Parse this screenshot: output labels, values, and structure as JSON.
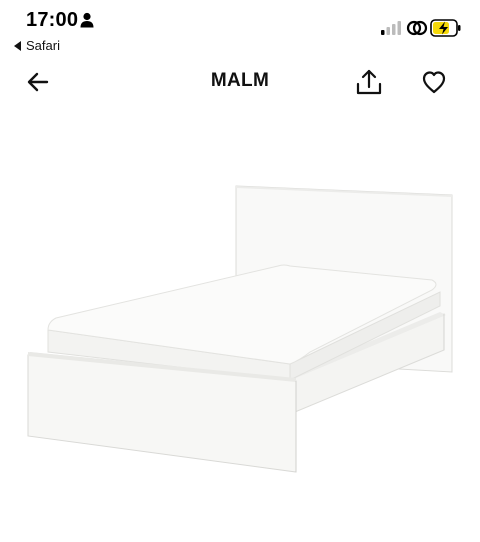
{
  "status_bar": {
    "time": "17:00",
    "back_app_label": "Safari"
  },
  "nav": {
    "title": "MALM"
  },
  "icons": {
    "back": "arrow-left-icon",
    "share": "share-icon",
    "favourite": "heart-icon",
    "person": "person-icon",
    "signal": "signal-icon",
    "link": "link-icon",
    "battery": "battery-charging-icon"
  },
  "colors": {
    "battery_fill": "#f5d90a",
    "text": "#111111",
    "background": "#ffffff"
  }
}
